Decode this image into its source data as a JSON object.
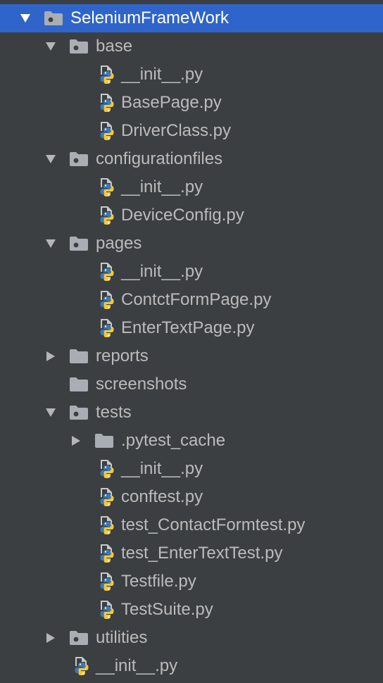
{
  "project_tree": {
    "colors": {
      "background": "#3c3f41",
      "selection": "#2f65ca",
      "text": "#bbbbbb",
      "folder": "#a8aeb3",
      "python_blue": "#3d78b3",
      "python_yellow": "#f2c840"
    },
    "items": [
      {
        "label": "SeleniumFrameWork",
        "type": "package",
        "depth": 0,
        "expanded": true,
        "selected": true
      },
      {
        "label": "base",
        "type": "package",
        "depth": 1,
        "expanded": true
      },
      {
        "label": "__init__.py",
        "type": "python",
        "depth": 2
      },
      {
        "label": "BasePage.py",
        "type": "python",
        "depth": 2
      },
      {
        "label": "DriverClass.py",
        "type": "python",
        "depth": 2
      },
      {
        "label": "configurationfiles",
        "type": "package",
        "depth": 1,
        "expanded": true
      },
      {
        "label": "__init__.py",
        "type": "python",
        "depth": 2
      },
      {
        "label": "DeviceConfig.py",
        "type": "python",
        "depth": 2
      },
      {
        "label": "pages",
        "type": "package",
        "depth": 1,
        "expanded": true
      },
      {
        "label": "__init__.py",
        "type": "python",
        "depth": 2
      },
      {
        "label": "ContctFormPage.py",
        "type": "python",
        "depth": 2
      },
      {
        "label": "EnterTextPage.py",
        "type": "python",
        "depth": 2
      },
      {
        "label": "reports",
        "type": "folder",
        "depth": 1,
        "expanded": false
      },
      {
        "label": "screenshots",
        "type": "folder",
        "depth": 1,
        "leaf": true
      },
      {
        "label": "tests",
        "type": "package",
        "depth": 1,
        "expanded": true
      },
      {
        "label": ".pytest_cache",
        "type": "folder",
        "depth": 2,
        "expanded": false
      },
      {
        "label": "__init__.py",
        "type": "python",
        "depth": 2
      },
      {
        "label": "conftest.py",
        "type": "python",
        "depth": 2
      },
      {
        "label": "test_ContactFormtest.py",
        "type": "python",
        "depth": 2
      },
      {
        "label": "test_EnterTextTest.py",
        "type": "python",
        "depth": 2
      },
      {
        "label": "Testfile.py",
        "type": "python",
        "depth": 2
      },
      {
        "label": "TestSuite.py",
        "type": "python",
        "depth": 2
      },
      {
        "label": "utilities",
        "type": "package",
        "depth": 1,
        "expanded": false
      },
      {
        "label": "__init__.py",
        "type": "python",
        "depth": 1
      }
    ]
  }
}
